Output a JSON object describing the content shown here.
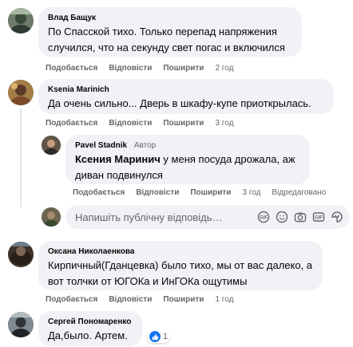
{
  "actions": {
    "like": "Подобається",
    "reply": "Відповісти",
    "share": "Поширити",
    "edited": "Відредаговано"
  },
  "comments": [
    {
      "author": "Влад Бащук",
      "lines": [
        "По Спасской тихо. Только перепад напряжения",
        "случился, что на секунду свет погас и включился"
      ],
      "time": "2 год"
    },
    {
      "author": "Ksenia Marinich",
      "lines": [
        "Да очень сильно... Дверь в шкафу-купе приоткрылась."
      ],
      "time": "3 год"
    },
    {
      "author": "Pavel Stadnik",
      "badge": "Автор",
      "mention": "Ксения Маринич",
      "lines": [
        " у меня посуда дрожала, аж",
        "диван подвинулся"
      ],
      "time": "3 год"
    },
    {
      "author": "Оксана Николаенкова",
      "lines": [
        "Кирпичный(Гданцевка) было тихо, мы от вас далеко, а",
        "вот толчки от ЮГОКа и ИнГОКа ощутимы"
      ],
      "time": "1 год"
    },
    {
      "author": "Сергей Пономаренко",
      "lines": [
        "Да,было. Артем."
      ],
      "reaction_count": "1"
    }
  ],
  "reply_box": {
    "placeholder": "Напишіть публічну відповідь…",
    "icons": [
      "gif-icon",
      "emoji-icon",
      "camera-icon",
      "gif-icon",
      "sticker-icon"
    ]
  },
  "colors": {
    "bubble": "#f0f2f5",
    "secondary_text": "#65676b",
    "author_badge": "#65676b",
    "like_blue": "#1877f2"
  }
}
